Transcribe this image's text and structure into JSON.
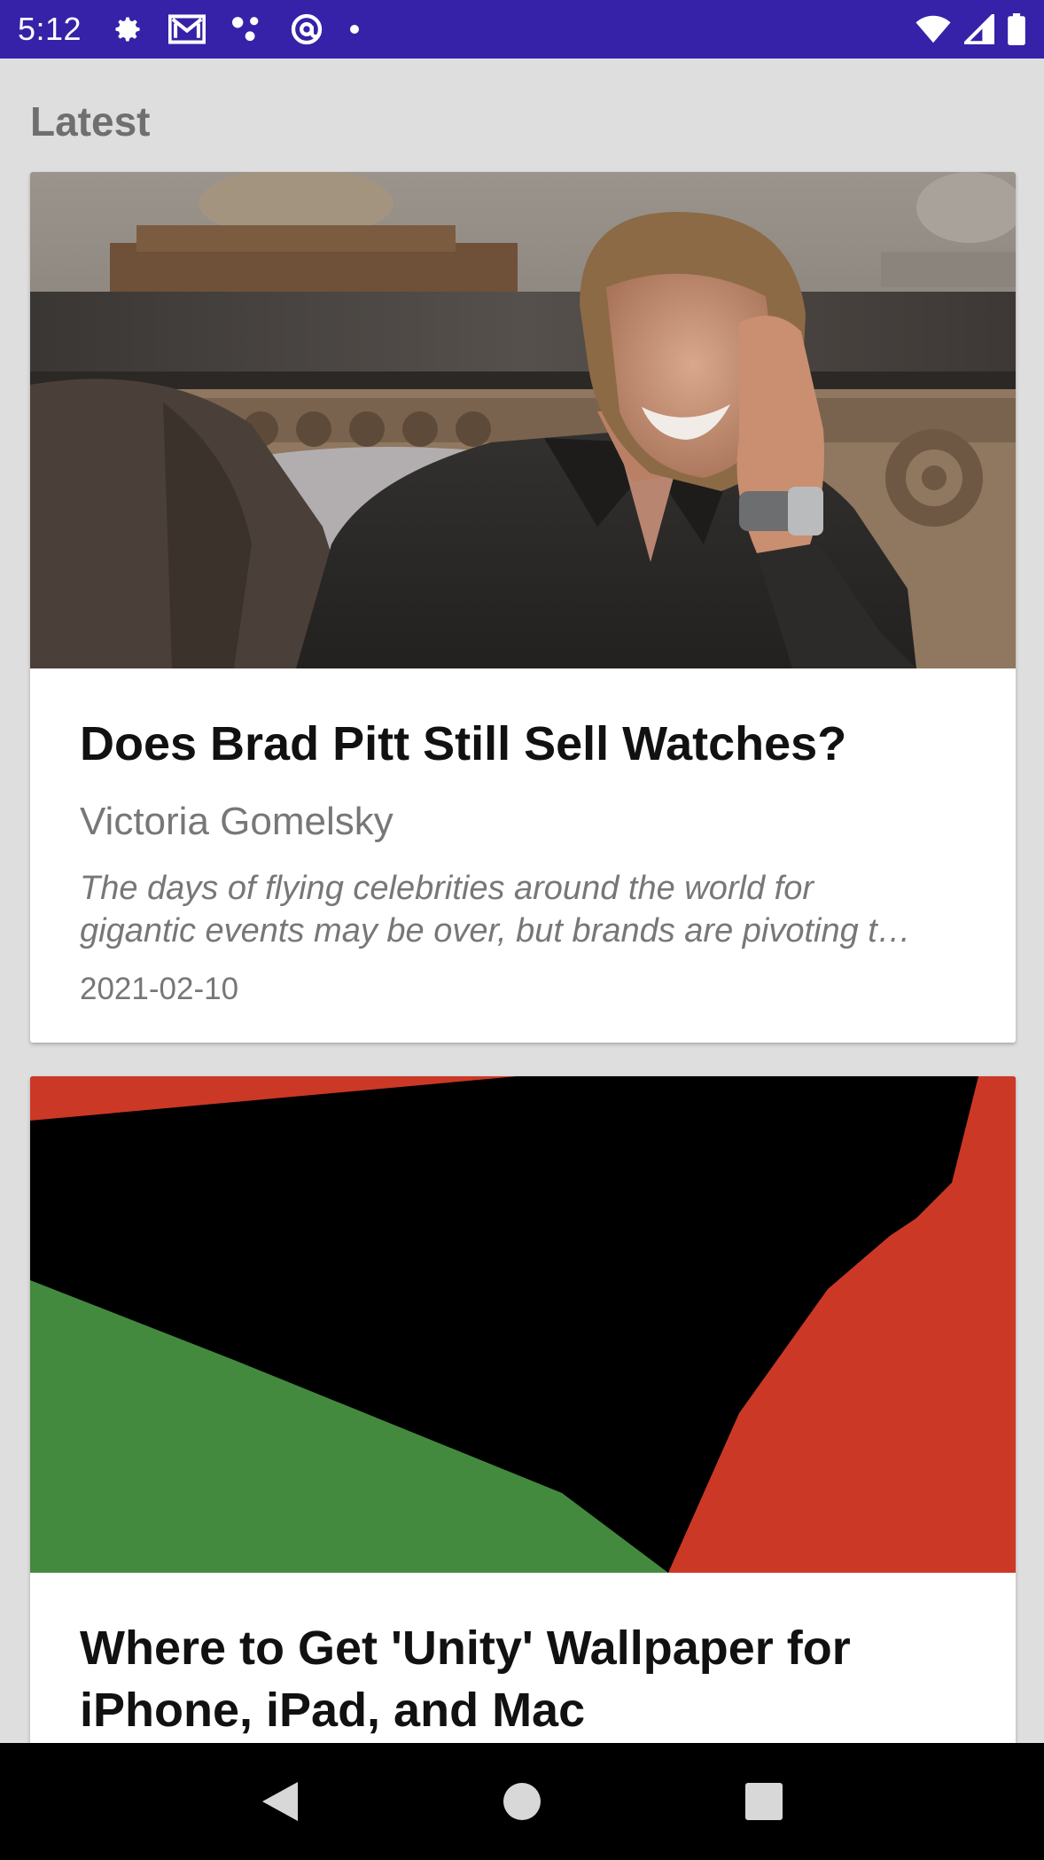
{
  "status_bar": {
    "time": "5:12",
    "left_icons": [
      "gear-icon",
      "gmail-icon",
      "dots-icon",
      "at-sign-icon",
      "dot-icon"
    ],
    "right_icons": [
      "wifi-icon",
      "signal-icon",
      "battery-icon"
    ],
    "background": "#3522a8"
  },
  "section": {
    "title": "Latest"
  },
  "articles": [
    {
      "title": "Does Brad Pitt Still Sell Watches?",
      "author": "Victoria Gomelsky",
      "description_line1": "The days of flying celebrities around the world for",
      "description_line2": "gigantic events may be over, but brands are pivoting t…",
      "date": "2021-02-10",
      "image": "photo-man-seated-laughing"
    },
    {
      "title_line1": "Where to Get 'Unity' Wallpaper for",
      "title_line2": "iPhone, iPad, and Mac",
      "image": "unity-wallpaper-red-black-green",
      "image_colors": {
        "red": "#cc3826",
        "black": "#000000",
        "green": "#448a3e"
      }
    }
  ],
  "nav_bar": {
    "buttons": [
      "back-icon",
      "home-icon",
      "recents-icon"
    ]
  }
}
